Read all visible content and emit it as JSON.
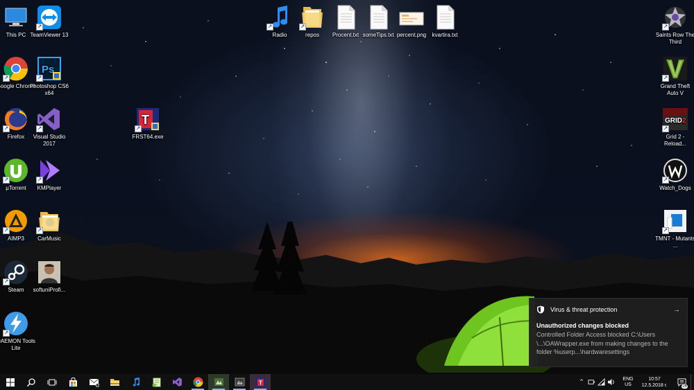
{
  "desktop": {
    "left_col1": [
      {
        "id": "this-pc",
        "label": "This PC"
      },
      {
        "id": "google-chrome",
        "label": "Google Chrome"
      },
      {
        "id": "firefox",
        "label": "Firefox"
      },
      {
        "id": "utorrent",
        "label": "µTorrent"
      },
      {
        "id": "aimp3",
        "label": "AIMP3"
      },
      {
        "id": "steam",
        "label": "Steam"
      },
      {
        "id": "daemon-tools",
        "label": "DAEMON Tools Lite"
      }
    ],
    "left_col2": [
      {
        "id": "teamviewer",
        "label": "TeamViewer 13"
      },
      {
        "id": "photoshop",
        "label": "Photoshop CS6 x64"
      },
      {
        "id": "visual-studio",
        "label": "Visual Studio 2017"
      },
      {
        "id": "kmplayer",
        "label": "KMPlayer"
      },
      {
        "id": "carmusic",
        "label": "CarMusic"
      },
      {
        "id": "softuni",
        "label": "softuniProfi..."
      }
    ],
    "frst": {
      "label": "FRST64.exe"
    },
    "top_row": [
      {
        "id": "radio",
        "label": "Radio"
      },
      {
        "id": "repos",
        "label": "repos"
      },
      {
        "id": "procent",
        "label": "Procent.txt"
      },
      {
        "id": "sometips",
        "label": "someTips.txt"
      },
      {
        "id": "percent-png",
        "label": "percent.png"
      },
      {
        "id": "kvartira",
        "label": "kvartira.txt"
      }
    ],
    "right_col": [
      {
        "id": "saints-row",
        "label": "Saints Row The Third"
      },
      {
        "id": "gta5",
        "label": "Grand Theft Auto V"
      },
      {
        "id": "grid2",
        "label": "Grid 2 - Reload..."
      },
      {
        "id": "watch-dogs",
        "label": "Watch_Dogs"
      },
      {
        "id": "tmnt",
        "label": "TMNT - Mutants ..."
      }
    ]
  },
  "toast": {
    "app": "Virus & threat protection",
    "title": "Unauthorized changes blocked",
    "body": "Controlled Folder Access blocked C:\\Users \\...\\OAWrapper.exe from making changes to the folder %userp...\\hardwaresettings",
    "icon": "shield-icon",
    "arrow": "→"
  },
  "taskbar": {
    "lang_top": "ENG",
    "lang_bottom": "US",
    "time": "10:57",
    "date": "12.5.2018 г.",
    "notification_count": "26",
    "accent": "#8fb0ff"
  }
}
